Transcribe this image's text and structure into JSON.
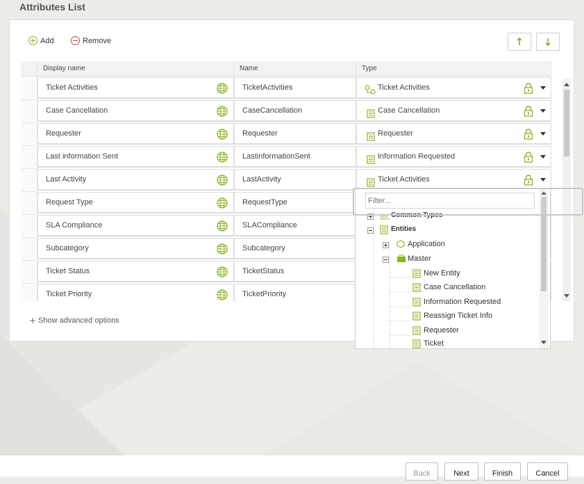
{
  "page": {
    "title": "Attributes List"
  },
  "toolbar": {
    "add_label": "Add",
    "remove_label": "Remove",
    "move_up_icon": "arrow-up-icon",
    "move_down_icon": "arrow-down-icon"
  },
  "grid": {
    "columns": [
      "Display name",
      "Name",
      "Type"
    ],
    "rows": [
      {
        "display_name": "Ticket Activities",
        "name": "TicketActivities",
        "type": "Ticket Activities",
        "type_icon": "activity-icon"
      },
      {
        "display_name": "Case Cancellation",
        "name": "CaseCancellation",
        "type": "Case Cancellation",
        "type_icon": "entity-icon"
      },
      {
        "display_name": "Requester",
        "name": "Requester",
        "type": "Requester",
        "type_icon": "entity-icon"
      },
      {
        "display_name": "Last information Sent",
        "name": "LastinformationSent",
        "type": "Information Requested",
        "type_icon": "entity-icon"
      },
      {
        "display_name": "Last Activity",
        "name": "LastActivity",
        "type": "Ticket Activities",
        "type_icon": "entity-icon"
      },
      {
        "display_name": "Request Type",
        "name": "RequestType",
        "type": "",
        "type_icon": ""
      },
      {
        "display_name": "SLA Compliance",
        "name": "SLACompliance",
        "type": "",
        "type_icon": ""
      },
      {
        "display_name": "Subcategory",
        "name": "Subcategory",
        "type": "",
        "type_icon": ""
      },
      {
        "display_name": "Ticket Status",
        "name": "TicketStatus",
        "type": "",
        "type_icon": ""
      },
      {
        "display_name": "Ticket Priority",
        "name": "TicketPriority",
        "type": "",
        "type_icon": ""
      }
    ]
  },
  "advanced": {
    "label": "Show advanced options"
  },
  "type_dropdown": {
    "filter_placeholder": "Filter...",
    "tree": [
      {
        "label": "Common Types",
        "expander": "+",
        "icon": "abc-icon"
      },
      {
        "label": "Entities",
        "expander": "-",
        "icon": "entity-icon"
      },
      {
        "label": "Application",
        "expander": "+",
        "icon": "application-icon"
      },
      {
        "label": "Master",
        "expander": "-",
        "icon": "folder-icon"
      },
      {
        "label": "New Entity",
        "expander": "",
        "icon": "entity-icon"
      },
      {
        "label": "Case Cancellation",
        "expander": "",
        "icon": "entity-icon"
      },
      {
        "label": "Information Requested",
        "expander": "",
        "icon": "entity-icon"
      },
      {
        "label": "Reassign Ticket Info",
        "expander": "",
        "icon": "entity-icon"
      },
      {
        "label": "Requester",
        "expander": "",
        "icon": "entity-icon"
      },
      {
        "label": "Ticket",
        "expander": "",
        "icon": "entity-icon"
      }
    ]
  },
  "footer": {
    "back_label": "Back",
    "next_label": "Next",
    "finish_label": "Finish",
    "cancel_label": "Cancel"
  },
  "colors": {
    "accent": "#8ab521",
    "remove": "#d23c3c",
    "background": "#ecece9"
  }
}
